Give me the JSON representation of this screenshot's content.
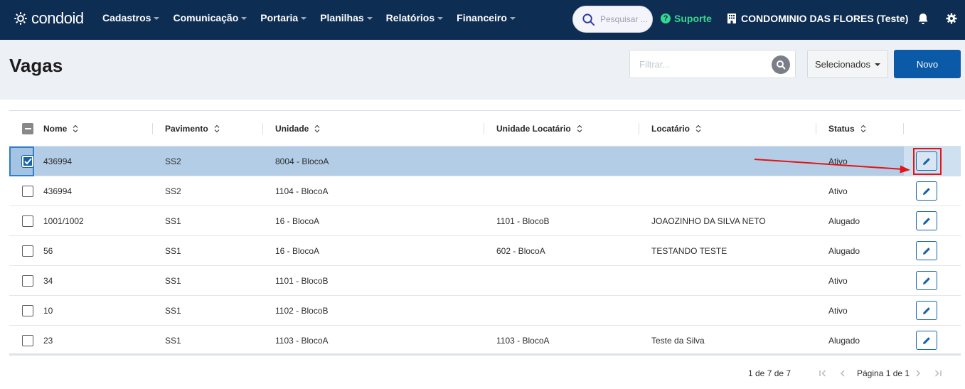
{
  "brand": {
    "name": "condoid"
  },
  "nav": {
    "items": [
      {
        "label": "Cadastros"
      },
      {
        "label": "Comunicação"
      },
      {
        "label": "Portaria"
      },
      {
        "label": "Planilhas"
      },
      {
        "label": "Relatórios"
      },
      {
        "label": "Financeiro"
      }
    ],
    "search_placeholder": "Pesquisar ...",
    "support_label": "Suporte",
    "condo_name": "CONDOMINIO DAS FLORES (Teste)"
  },
  "page": {
    "title": "Vagas",
    "filter_placeholder": "Filtrar...",
    "selected_label": "Selecionados",
    "new_label": "Novo"
  },
  "table": {
    "columns": [
      "Nome",
      "Pavimento",
      "Unidade",
      "Unidade Locatário",
      "Locatário",
      "Status"
    ],
    "rows": [
      {
        "nome": "436994",
        "pavimento": "SS2",
        "unidade": "8004 - BlocoA",
        "unidade_locatario": "",
        "locatario": "",
        "status": "Ativo",
        "selected": true
      },
      {
        "nome": "436994",
        "pavimento": "SS2",
        "unidade": "1104 - BlocoA",
        "unidade_locatario": "",
        "locatario": "",
        "status": "Ativo",
        "selected": false
      },
      {
        "nome": "1001/1002",
        "pavimento": "SS1",
        "unidade": "16 - BlocoA",
        "unidade_locatario": "1101 - BlocoB",
        "locatario": "JOAOZINHO DA SILVA NETO",
        "status": "Alugado",
        "selected": false
      },
      {
        "nome": "56",
        "pavimento": "SS1",
        "unidade": "16 - BlocoA",
        "unidade_locatario": "602 - BlocoA",
        "locatario": "TESTANDO TESTE",
        "status": "Alugado",
        "selected": false
      },
      {
        "nome": "34",
        "pavimento": "SS1",
        "unidade": "1101 - BlocoB",
        "unidade_locatario": "",
        "locatario": "",
        "status": "Ativo",
        "selected": false
      },
      {
        "nome": "10",
        "pavimento": "SS1",
        "unidade": "1102 - BlocoB",
        "unidade_locatario": "",
        "locatario": "",
        "status": "Ativo",
        "selected": false
      },
      {
        "nome": "23",
        "pavimento": "SS1",
        "unidade": "1103 - BlocoA",
        "unidade_locatario": "1103 - BlocoA",
        "locatario": "Teste da Silva",
        "status": "Alugado",
        "selected": false
      }
    ]
  },
  "pagination": {
    "range": "1 de 7 de 7",
    "page_text": "Página 1 de 1"
  },
  "colors": {
    "navbar": "#0e2d52",
    "accent": "#0b5aa8",
    "support": "#35d88e",
    "selected_row": "#b3cde6",
    "annotation": "#e31414"
  }
}
